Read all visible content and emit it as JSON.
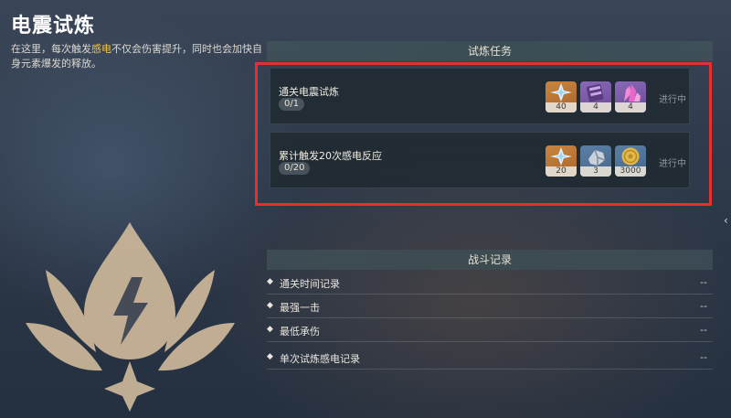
{
  "title": "电震试炼",
  "description": {
    "part1": "在这里，每次触发",
    "highlight": "感电",
    "part2": "不仅会伤害提升，同时也会加快自身元素爆发的释放。"
  },
  "missions": {
    "header": "试炼任务",
    "items": [
      {
        "name": "通关电震试炼",
        "progress": "0/1",
        "status": "进行中",
        "rewards": [
          {
            "icon": "primogem-icon",
            "qty": "40"
          },
          {
            "icon": "purple-material-icon",
            "qty": "4"
          },
          {
            "icon": "crystal-ore-icon",
            "qty": "4"
          }
        ]
      },
      {
        "name": "累计触发20次感电反应",
        "progress": "0/20",
        "status": "进行中",
        "rewards": [
          {
            "icon": "primogem-icon",
            "qty": "20"
          },
          {
            "icon": "enhancement-ore-icon",
            "qty": "3"
          },
          {
            "icon": "mora-coin-icon",
            "qty": "3000"
          }
        ]
      }
    ]
  },
  "battle_records": {
    "header": "战斗记录",
    "items": [
      {
        "label": "通关时间记录",
        "value": "--"
      },
      {
        "label": "最强一击",
        "value": "--"
      },
      {
        "label": "最低承伤",
        "value": "--"
      },
      {
        "label": "单次试炼感电记录",
        "value": "--"
      }
    ]
  },
  "colors": {
    "highlight": "#f5c542",
    "frame": "#e5302f",
    "emblem": "#cdb89a"
  }
}
